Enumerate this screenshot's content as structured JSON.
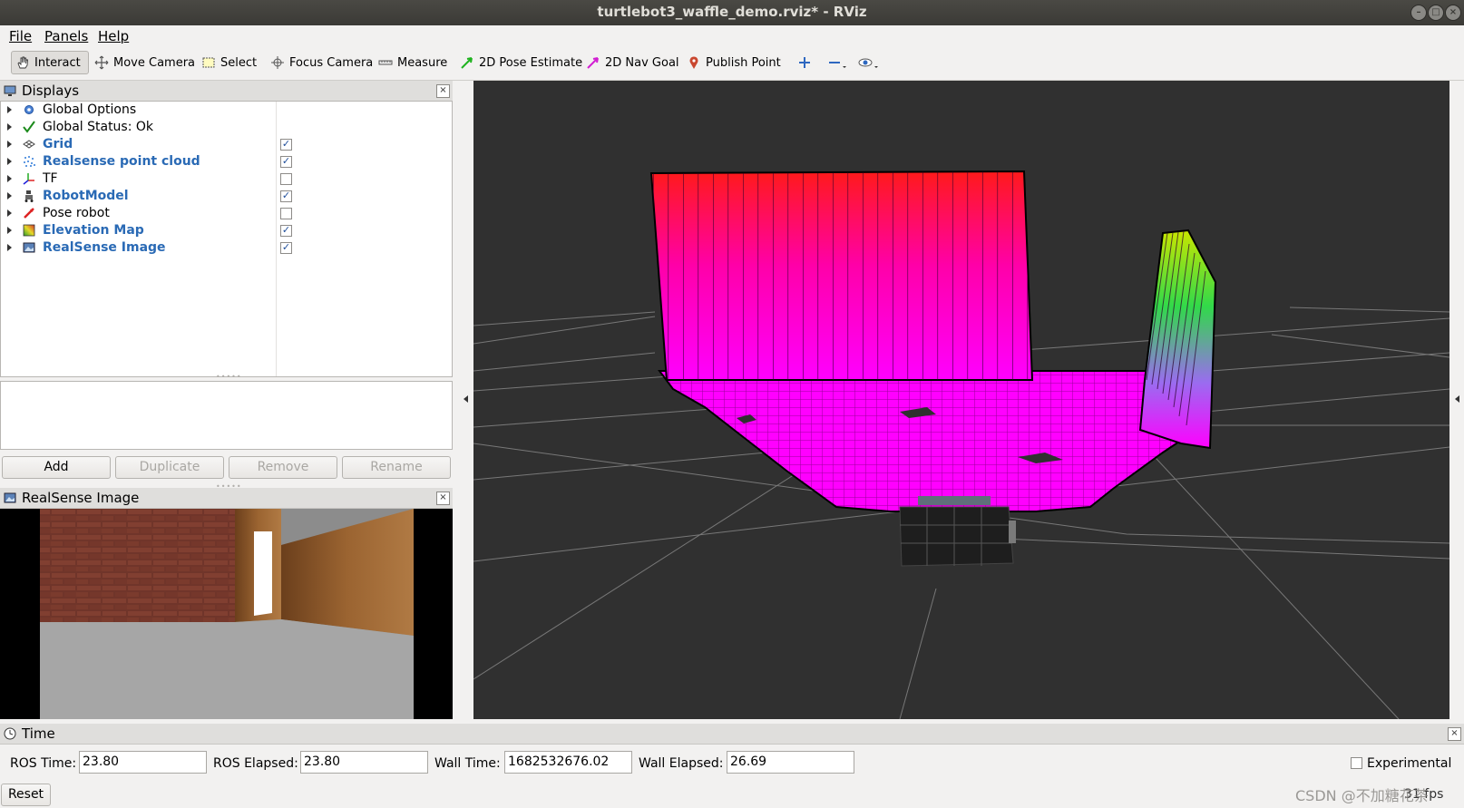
{
  "window": {
    "title": "turtlebot3_waffle_demo.rviz* - RViz"
  },
  "menu": {
    "file": "File",
    "panels": "Panels",
    "help": "Help"
  },
  "toolbar": {
    "interact": "Interact",
    "move_camera": "Move Camera",
    "select": "Select",
    "focus_camera": "Focus Camera",
    "measure": "Measure",
    "pose_estimate": "2D Pose Estimate",
    "nav_goal": "2D Nav Goal",
    "publish_point": "Publish Point"
  },
  "displays": {
    "title": "Displays",
    "items": [
      {
        "label": "Global Options",
        "icon": "gear-icon",
        "checkbox": null,
        "enabled_style": false
      },
      {
        "label": "Global Status: Ok",
        "icon": "check-icon",
        "checkbox": null,
        "enabled_style": false
      },
      {
        "label": "Grid",
        "icon": "grid-icon",
        "checkbox": true,
        "enabled_style": true
      },
      {
        "label": "Realsense point cloud",
        "icon": "pointcloud-icon",
        "checkbox": true,
        "enabled_style": true
      },
      {
        "label": "TF",
        "icon": "tf-axes-icon",
        "checkbox": false,
        "enabled_style": false
      },
      {
        "label": "RobotModel",
        "icon": "robot-icon",
        "checkbox": true,
        "enabled_style": true
      },
      {
        "label": "Pose robot",
        "icon": "pose-arrow-icon",
        "checkbox": false,
        "enabled_style": false
      },
      {
        "label": "Elevation Map",
        "icon": "map-icon",
        "checkbox": true,
        "enabled_style": true
      },
      {
        "label": "RealSense Image",
        "icon": "image-icon",
        "checkbox": true,
        "enabled_style": true
      }
    ],
    "buttons": {
      "add": "Add",
      "duplicate": "Duplicate",
      "remove": "Remove",
      "rename": "Rename"
    }
  },
  "image_panel": {
    "title": "RealSense Image"
  },
  "time": {
    "title": "Time",
    "ros_time_label": "ROS Time:",
    "ros_time": "23.80",
    "ros_elapsed_label": "ROS Elapsed:",
    "ros_elapsed": "23.80",
    "wall_time_label": "Wall Time:",
    "wall_time": "1682532676.02",
    "wall_elapsed_label": "Wall Elapsed:",
    "wall_elapsed": "26.69",
    "experimental": "Experimental",
    "reset": "Reset",
    "fps": "31 fps"
  },
  "watermark": "CSDN @不加糖花茶"
}
